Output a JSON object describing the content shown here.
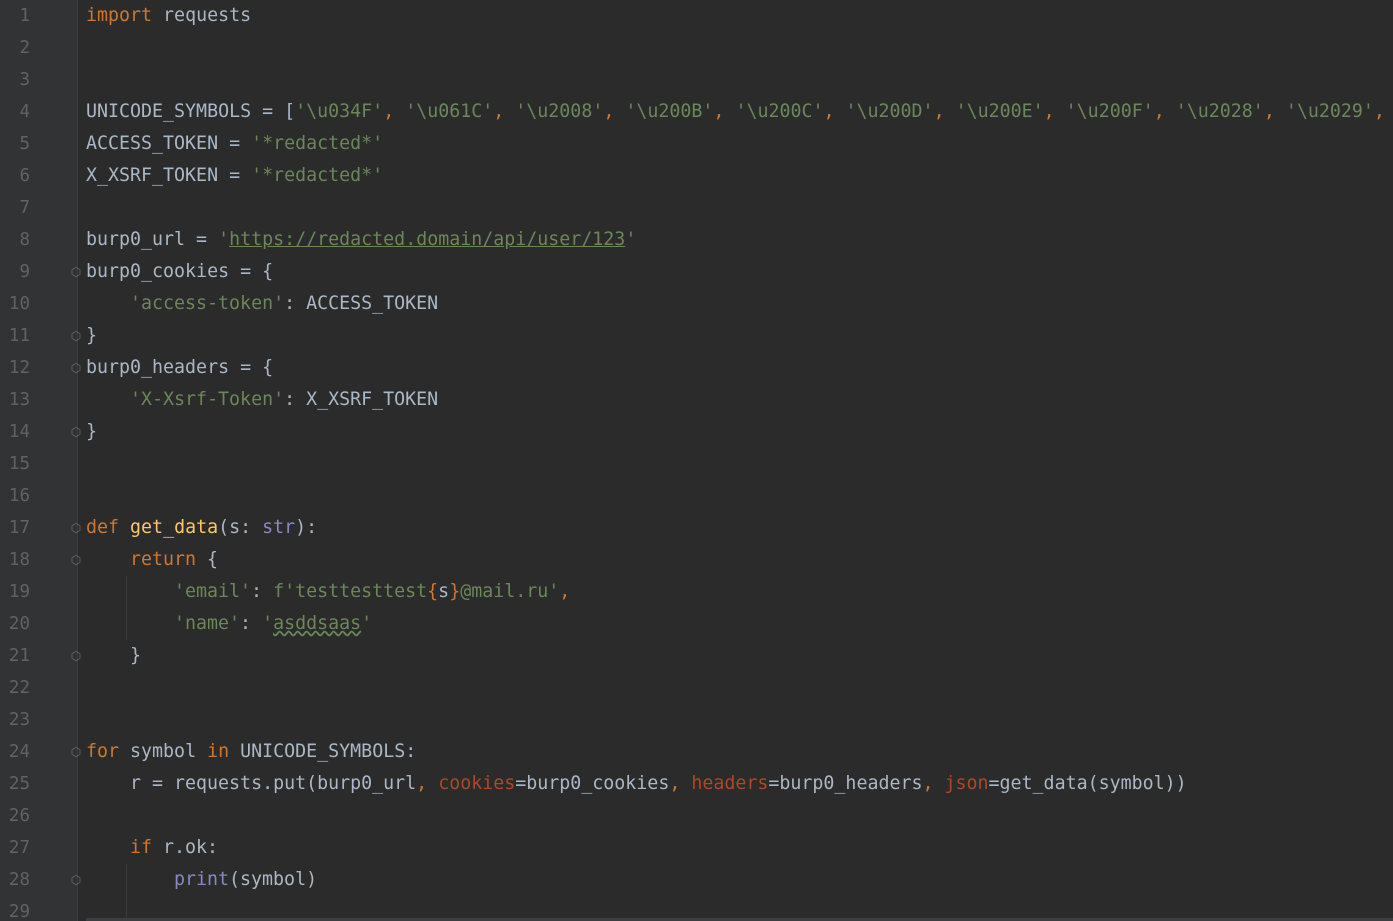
{
  "editor": {
    "language": "python",
    "line_numbers": [
      "1",
      "2",
      "3",
      "4",
      "5",
      "6",
      "7",
      "8",
      "9",
      "10",
      "11",
      "12",
      "13",
      "14",
      "15",
      "16",
      "17",
      "18",
      "19",
      "20",
      "21",
      "22",
      "23",
      "24",
      "25",
      "26",
      "27",
      "28",
      "29"
    ],
    "lines": {
      "l1_kw": "import",
      "l1_rest": " requests",
      "l4_name": "UNICODE_SYMBOLS = [",
      "l4_items": [
        "'\\u034F'",
        "'\\u061C'",
        "'\\u2008'",
        "'\\u200B'",
        "'\\u200C'",
        "'\\u200D'",
        "'\\u200E'",
        "'\\u200F'",
        "'\\u2028'",
        "'\\u2029'"
      ],
      "l5_name": "ACCESS_TOKEN = ",
      "l5_val": "'*redacted*'",
      "l6_name": "X_XSRF_TOKEN = ",
      "l6_val": "'*redacted*'",
      "l8_name": "burp0_url = ",
      "l8_q1": "'",
      "l8_url": "https://redacted.domain/api/user/123",
      "l8_q2": "'",
      "l9": "burp0_cookies = {",
      "l10_key": "'access-token'",
      "l10_rest": ": ACCESS_TOKEN",
      "l11": "}",
      "l12": "burp0_headers = {",
      "l13_key": "'X-Xsrf-Token'",
      "l13_rest": ": X_XSRF_TOKEN",
      "l14": "}",
      "l17_def": "def",
      "l17_fn": "get_data",
      "l17_a": "(s: ",
      "l17_type": "str",
      "l17_b": "):",
      "l18_kw": "return",
      "l18_rest": " {",
      "l19_key": "'email'",
      "l19_colon": ": ",
      "l19_f1": "f'testtesttest",
      "l19_brace1": "{",
      "l19_s": "s",
      "l19_brace2": "}",
      "l19_f2": "@mail.ru'",
      "l19_comma": ",",
      "l20_key": "'name'",
      "l20_colon": ": ",
      "l20_q1": "'",
      "l20_val": "asddsaas",
      "l20_q2": "'",
      "l21": "}",
      "l24_for": "for",
      "l24_a": " symbol ",
      "l24_in": "in",
      "l24_b": " UNICODE_SYMBOLS:",
      "l25_a": "r = requests.put(burp0_url",
      "l25_c1": ", ",
      "l25_k1": "cookies",
      "l25_b": "=burp0_cookies",
      "l25_c2": ", ",
      "l25_k2": "headers",
      "l25_c": "=burp0_headers",
      "l25_c3": ", ",
      "l25_k3": "json",
      "l25_d": "=get_data(symbol))",
      "l27_if": "if",
      "l27_rest": " r.ok:",
      "l28_print": "print",
      "l28_rest": "(symbol)"
    }
  },
  "colors": {
    "background": "#2b2b2b",
    "keyword": "#cc7832",
    "string": "#6a8759",
    "function": "#ffc66d",
    "builtin": "#8888c6",
    "kwarg": "#aa4926",
    "text": "#a9b7c6",
    "line_number": "#606366"
  }
}
